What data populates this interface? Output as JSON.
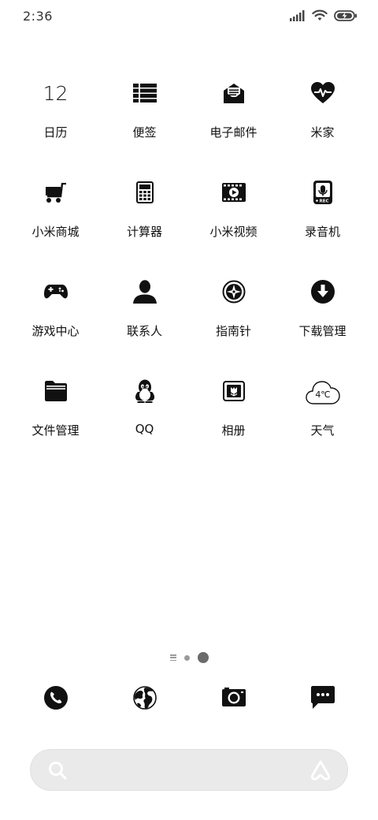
{
  "status_bar": {
    "time": "2:36",
    "icons": [
      "signal-icon",
      "wifi-icon",
      "battery-charging-icon"
    ]
  },
  "calendar_day": "12",
  "apps": [
    [
      {
        "label": "日历",
        "icon": "calendar-icon"
      },
      {
        "label": "便签",
        "icon": "notes-list-icon"
      },
      {
        "label": "电子邮件",
        "icon": "mail-icon"
      },
      {
        "label": "米家",
        "icon": "heart-pulse-icon"
      }
    ],
    [
      {
        "label": "小米商城",
        "icon": "shopping-cart-icon"
      },
      {
        "label": "计算器",
        "icon": "calculator-icon"
      },
      {
        "label": "小米视频",
        "icon": "video-icon"
      },
      {
        "label": "录音机",
        "icon": "recorder-icon"
      }
    ],
    [
      {
        "label": "游戏中心",
        "icon": "gamepad-icon"
      },
      {
        "label": "联系人",
        "icon": "person-icon"
      },
      {
        "label": "指南针",
        "icon": "compass-icon"
      },
      {
        "label": "下载管理",
        "icon": "download-icon"
      }
    ],
    [
      {
        "label": "文件管理",
        "icon": "folder-icon"
      },
      {
        "label": "QQ",
        "icon": "qq-penguin-icon"
      },
      {
        "label": "相册",
        "icon": "gallery-icon"
      },
      {
        "label": "天气",
        "icon": "weather-cloud-icon"
      }
    ]
  ],
  "recorder_badge": "REC",
  "weather_temp": "4℃",
  "dock": [
    "phone-icon",
    "browser-globe-icon",
    "camera-icon",
    "messages-icon"
  ],
  "search": {
    "icons": [
      "search-icon",
      "assistant-icon"
    ]
  }
}
